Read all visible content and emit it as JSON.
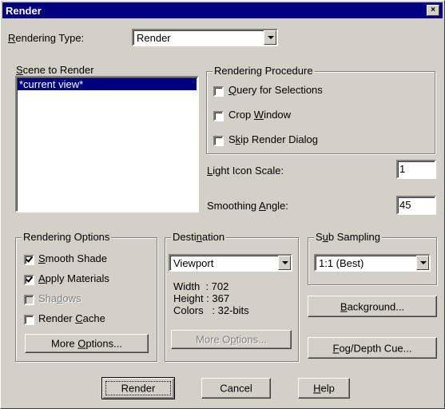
{
  "window": {
    "title": "Render",
    "close_glyph": "×"
  },
  "rendering_type": {
    "label": "Rendering Type:",
    "mnemonic": "R",
    "label_rest": "endering Type:",
    "value": "Render"
  },
  "scene": {
    "label_mnemonic": "S",
    "label_rest": "cene to Render",
    "items": [
      "*current view*"
    ]
  },
  "procedure": {
    "title": "Rendering Procedure",
    "query": {
      "pre": "",
      "mn": "Q",
      "post": "uery for Selections",
      "checked": false
    },
    "crop": {
      "pre": "Crop ",
      "mn": "W",
      "post": "indow",
      "checked": false
    },
    "skip": {
      "pre": "S",
      "mn": "k",
      "post": "ip Render Dialog",
      "checked": false
    }
  },
  "light_icon_scale": {
    "pre": "",
    "mn": "L",
    "post": "ight Icon Scale:",
    "value": "1"
  },
  "smoothing_angle": {
    "pre": "Smoothing ",
    "mn": "A",
    "post": "ngle:",
    "value": "45"
  },
  "rendering_options": {
    "title": "Rendering Options",
    "smooth_shade": {
      "pre": "",
      "mn": "S",
      "post": "mooth Shade",
      "checked": true
    },
    "apply_materials": {
      "pre": "",
      "mn": "A",
      "post": "pply Materials",
      "checked": true
    },
    "shadows": {
      "pre": "Sha",
      "mn": "d",
      "post": "ows",
      "checked": false,
      "disabled": true
    },
    "render_cache": {
      "pre": "Render ",
      "mn": "C",
      "post": "ache",
      "checked": false
    },
    "more_options": {
      "pre": "More ",
      "mn": "O",
      "post": "ptions..."
    }
  },
  "destination": {
    "title_pre": "Desti",
    "title_mn": "n",
    "title_post": "ation",
    "value": "Viewport",
    "width_line": "Width  : 702",
    "height_line": "Height : 367",
    "colors_line": "Colors   : 32-bits",
    "more_options": {
      "pre": "More O",
      "mn": "p",
      "post": "tions..."
    }
  },
  "sub_sampling": {
    "title_pre": "S",
    "title_mn": "u",
    "title_post": "b Sampling",
    "value": "1:1 (Best)"
  },
  "background_button": {
    "pre": "",
    "mn": "B",
    "post": "ackground..."
  },
  "fog_button": {
    "pre": "",
    "mn": "F",
    "post": "og/Depth Cue..."
  },
  "footer": {
    "render": "Render",
    "cancel": "Cancel",
    "help_mn": "H",
    "help_post": "elp"
  }
}
